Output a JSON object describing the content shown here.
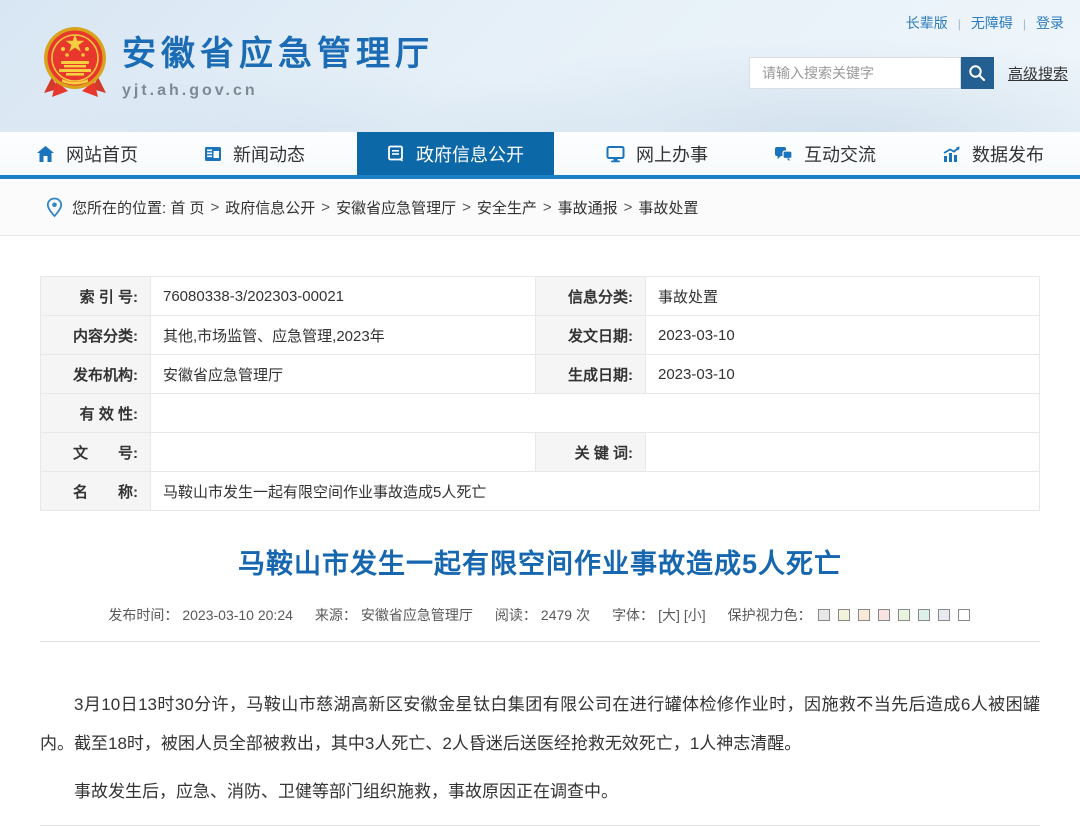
{
  "topbar": {
    "links": [
      "长辈版",
      "无障碍",
      "登录"
    ]
  },
  "header": {
    "site_title": "安徽省应急管理厅",
    "site_url": "yjt.ah.gov.cn",
    "search_placeholder": "请输入搜索关键字",
    "advanced_search": "高级搜索"
  },
  "nav": {
    "items": [
      {
        "label": "网站首页"
      },
      {
        "label": "新闻动态"
      },
      {
        "label": "政府信息公开"
      },
      {
        "label": "网上办事"
      },
      {
        "label": "互动交流"
      },
      {
        "label": "数据发布"
      }
    ]
  },
  "breadcrumb": {
    "prefix": "您所在的位置:",
    "separator": ">",
    "items": [
      "首 页",
      "政府信息公开",
      "安徽省应急管理厅",
      "安全生产",
      "事故通报",
      "事故处置"
    ]
  },
  "info_table": {
    "rows": [
      {
        "c0": "索 引 号:",
        "v0": "76080338-3/202303-00021",
        "c1": "信息分类:",
        "v1": "事故处置"
      },
      {
        "c0": "内容分类:",
        "v0": "其他,市场监管、应急管理,2023年",
        "c1": "发文日期:",
        "v1": "2023-03-10"
      },
      {
        "c0": "发布机构:",
        "v0": "安徽省应急管理厅",
        "c1": "生成日期:",
        "v1": "2023-03-10"
      },
      {
        "c0": "有 效 性:",
        "v0": ""
      },
      {
        "c0": "文　　号:",
        "v0": "",
        "c1": "关 键 词:",
        "v1": ""
      },
      {
        "c0": "名　　称:",
        "v0": "马鞍山市发生一起有限空间作业事故造成5人死亡"
      }
    ]
  },
  "article": {
    "title": "马鞍山市发生一起有限空间作业事故造成5人死亡",
    "meta": {
      "publish_label": "发布时间：",
      "publish_time": "2023-03-10 20:24",
      "source_label": "来源：",
      "source": "安徽省应急管理厅",
      "views_label": "阅读：",
      "views": "2479",
      "views_unit": "次",
      "font_label": "字体：",
      "font_large": "[大]",
      "font_small": "[小]",
      "eye_label": "保护视力色：",
      "eye_colors": [
        "#e9e9e9",
        "#f2f2d8",
        "#f9ead8",
        "#f9e2e2",
        "#e8f4df",
        "#ddf0e7",
        "#e9e9f1",
        "#ffffff"
      ]
    },
    "paragraphs": [
      "3月10日13时30分许，马鞍山市慈湖高新区安徽金星钛白集团有限公司在进行罐体检修作业时，因施救不当先后造成6人被困罐内。截至18时，被困人员全部被救出，其中3人死亡、2人昏迷后送医经抢救无效死亡，1人神志清醒。",
      "事故发生后，应急、消防、卫健等部门组织施救，事故原因正在调查中。"
    ]
  },
  "colors": {
    "nav_active": "#0d68a8",
    "nav_strip": "#1e80c4",
    "title_blue": "#1667b0",
    "header_title_blue": "#1b6cb5",
    "search_button": "#235f90"
  }
}
